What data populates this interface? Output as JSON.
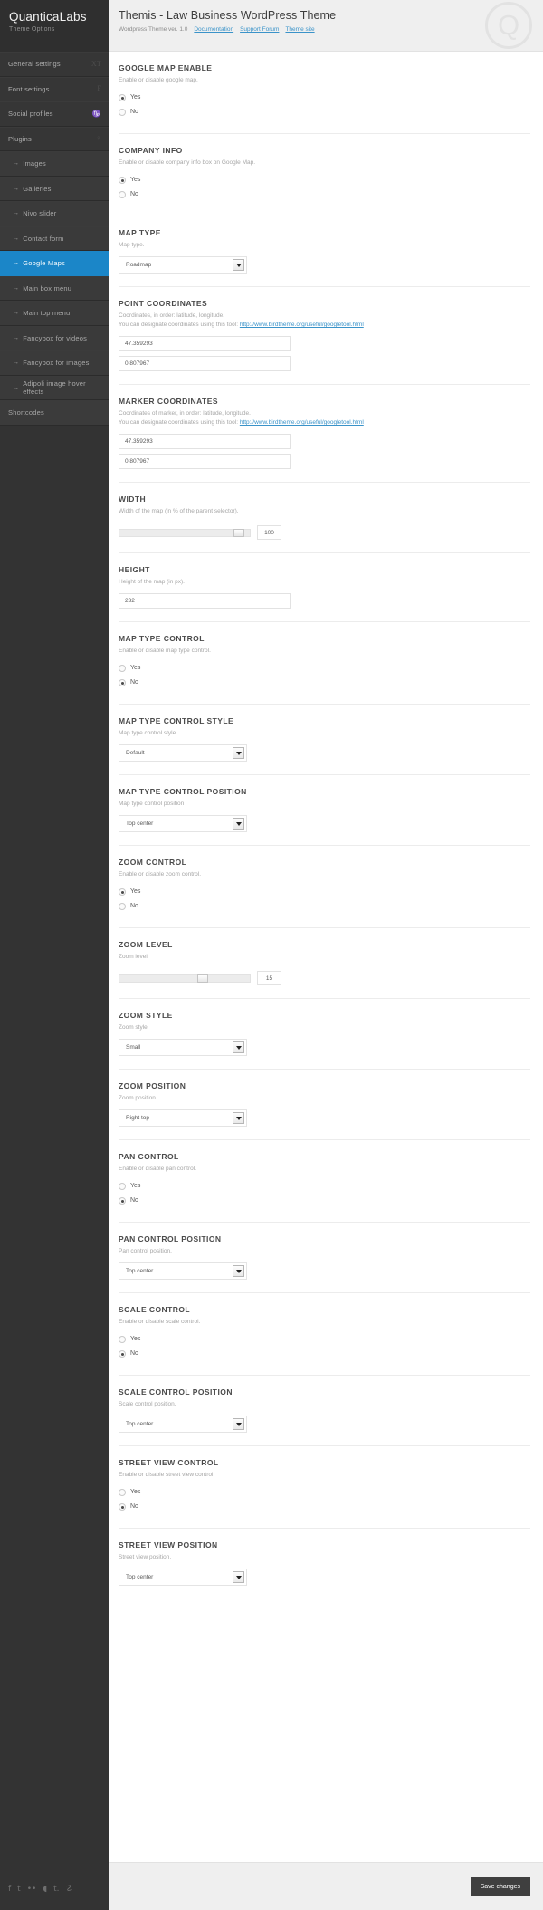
{
  "brand": {
    "title": "QuanticaLabs",
    "subtitle": "Theme Options"
  },
  "header": {
    "title": "Themis - Law Business WordPress Theme",
    "version": "Wordpress Theme ver. 1.0",
    "links": [
      {
        "label": "Documentation"
      },
      {
        "label": "Support Forum"
      },
      {
        "label": "Theme site"
      }
    ],
    "logo_letter": "Q"
  },
  "sidebar": {
    "items": [
      {
        "label": "General settings",
        "icon": "XT",
        "sub": false,
        "active": false
      },
      {
        "label": "Font settings",
        "icon": "F",
        "sub": false,
        "active": false
      },
      {
        "label": "Social profiles",
        "icon": "♑",
        "sub": false,
        "active": false
      },
      {
        "label": "Plugins",
        "icon": "♀",
        "sub": false,
        "active": false
      },
      {
        "label": "Images",
        "icon": "",
        "sub": true,
        "active": false
      },
      {
        "label": "Galleries",
        "icon": "",
        "sub": true,
        "active": false
      },
      {
        "label": "Nivo slider",
        "icon": "",
        "sub": true,
        "active": false
      },
      {
        "label": "Contact form",
        "icon": "",
        "sub": true,
        "active": false
      },
      {
        "label": "Google Maps",
        "icon": "",
        "sub": true,
        "active": true
      },
      {
        "label": "Main box menu",
        "icon": "",
        "sub": true,
        "active": false
      },
      {
        "label": "Main top menu",
        "icon": "",
        "sub": true,
        "active": false
      },
      {
        "label": "Fancybox for videos",
        "icon": "",
        "sub": true,
        "active": false
      },
      {
        "label": "Fancybox for images",
        "icon": "",
        "sub": true,
        "active": false
      },
      {
        "label": "Adipoli image hover effects",
        "icon": "",
        "sub": true,
        "active": false
      },
      {
        "label": "Shortcodes",
        "icon": "",
        "sub": false,
        "active": false,
        "foot": true
      }
    ],
    "arrow_glyph": "→",
    "social_icons": [
      {
        "name": "facebook-icon",
        "glyph": "f"
      },
      {
        "name": "twitter-icon",
        "glyph": "t"
      },
      {
        "name": "flickr-icon",
        "glyph": "••"
      },
      {
        "name": "dribbble-icon",
        "glyph": "◖"
      },
      {
        "name": "tumblr-icon",
        "glyph": "t."
      },
      {
        "name": "rss-icon",
        "glyph": "☡"
      }
    ]
  },
  "fields": [
    {
      "id": "google-map-enable",
      "title": "GOOGLE MAP ENABLE",
      "desc": "Enable or disable google map.",
      "type": "radio",
      "options": [
        {
          "label": "Yes",
          "checked": true
        },
        {
          "label": "No",
          "checked": false
        }
      ]
    },
    {
      "id": "company-info",
      "title": "COMPANY INFO",
      "desc": "Enable or disable company info box on Google Map.",
      "type": "radio",
      "options": [
        {
          "label": "Yes",
          "checked": true
        },
        {
          "label": "No",
          "checked": false
        }
      ]
    },
    {
      "id": "map-type",
      "title": "MAP TYPE",
      "desc": "Map type.",
      "type": "select",
      "value": "Roadmap"
    },
    {
      "id": "point-coordinates",
      "title": "POINT COORDINATES",
      "desc": "Coordinates, in order: latitude, longitude.",
      "desc2_prefix": "You can designate coordinates using this tool: ",
      "desc2_link": "http://www.birdtheme.org/useful/googletool.html",
      "type": "text2",
      "value1": "47.359293",
      "value2": "0.807967"
    },
    {
      "id": "marker-coordinates",
      "title": "MARKER COORDINATES",
      "desc": "Coordinates of marker, in order: latitude, longitude.",
      "desc2_prefix": "You can designate coordinates using this tool: ",
      "desc2_link": "http://www.birdtheme.org/useful/googletool.html",
      "type": "text2",
      "value1": "47.359293",
      "value2": "0.807967"
    },
    {
      "id": "width",
      "title": "WIDTH",
      "desc": "Width of the map (in % of the parent selector).",
      "type": "slider",
      "value": "100",
      "handle_pct": 92
    },
    {
      "id": "height",
      "title": "HEIGHT",
      "desc": "Height of the map (in px).",
      "type": "text",
      "value": "232"
    },
    {
      "id": "map-type-control",
      "title": "MAP TYPE CONTROL",
      "desc": "Enable or disable map type control.",
      "type": "radio",
      "options": [
        {
          "label": "Yes",
          "checked": false
        },
        {
          "label": "No",
          "checked": true
        }
      ]
    },
    {
      "id": "map-type-control-style",
      "title": "MAP TYPE CONTROL STYLE",
      "desc": "Map type control style.",
      "type": "select",
      "value": "Default"
    },
    {
      "id": "map-type-control-position",
      "title": "MAP TYPE CONTROL POSITION",
      "desc": "Map type control position",
      "type": "select",
      "value": "Top center"
    },
    {
      "id": "zoom-control",
      "title": "ZOOM CONTROL",
      "desc": "Enable or disable zoom control.",
      "type": "radio",
      "options": [
        {
          "label": "Yes",
          "checked": true
        },
        {
          "label": "No",
          "checked": false
        }
      ]
    },
    {
      "id": "zoom-level",
      "title": "ZOOM LEVEL",
      "desc": "Zoom level.",
      "type": "slider",
      "value": "15",
      "handle_pct": 64
    },
    {
      "id": "zoom-style",
      "title": "ZOOM STYLE",
      "desc": "Zoom style.",
      "type": "select",
      "value": "Small"
    },
    {
      "id": "zoom-position",
      "title": "ZOOM POSITION",
      "desc": "Zoom position.",
      "type": "select",
      "value": "Right top"
    },
    {
      "id": "pan-control",
      "title": "PAN CONTROL",
      "desc": "Enable or disable pan control.",
      "type": "radio",
      "options": [
        {
          "label": "Yes",
          "checked": false
        },
        {
          "label": "No",
          "checked": true
        }
      ]
    },
    {
      "id": "pan-control-position",
      "title": "PAN CONTROL POSITION",
      "desc": "Pan control position.",
      "type": "select",
      "value": "Top center"
    },
    {
      "id": "scale-control",
      "title": "SCALE CONTROL",
      "desc": "Enable or disable scale control.",
      "type": "radio",
      "options": [
        {
          "label": "Yes",
          "checked": false
        },
        {
          "label": "No",
          "checked": true
        }
      ]
    },
    {
      "id": "scale-control-position",
      "title": "SCALE CONTROL POSITION",
      "desc": "Scale control position.",
      "type": "select",
      "value": "Top center"
    },
    {
      "id": "street-view-control",
      "title": "STREET VIEW CONTROL",
      "desc": "Enable or disable street view control.",
      "type": "radio",
      "options": [
        {
          "label": "Yes",
          "checked": false
        },
        {
          "label": "No",
          "checked": true
        }
      ]
    },
    {
      "id": "street-view-position",
      "title": "STREET VIEW POSITION",
      "desc": "Street view position.",
      "type": "select",
      "value": "Top center"
    }
  ],
  "footer": {
    "save_label": "Save changes"
  },
  "colors": {
    "accent": "#1b86c8",
    "sidebar": "#333333",
    "link": "#3a93c9"
  }
}
